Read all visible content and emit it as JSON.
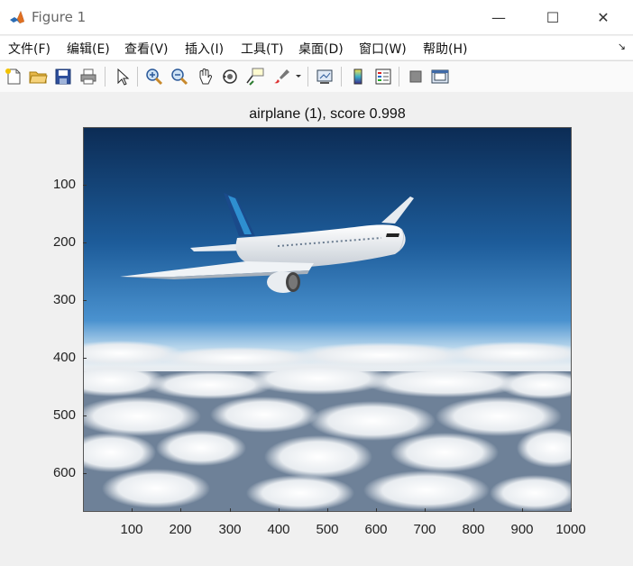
{
  "window": {
    "title": "Figure 1",
    "controls": {
      "minimize": "—",
      "maximize": "☐",
      "close": "✕"
    }
  },
  "menubar": {
    "items": [
      {
        "label": "文件(F)"
      },
      {
        "label": "编辑(E)"
      },
      {
        "label": "查看(V)"
      },
      {
        "label": "插入(I)"
      },
      {
        "label": "工具(T)"
      },
      {
        "label": "桌面(D)"
      },
      {
        "label": "窗口(W)"
      },
      {
        "label": "帮助(H)"
      }
    ],
    "dock_arrow": "↘"
  },
  "toolbar": {
    "buttons": [
      "new-figure-icon",
      "open-file-icon",
      "save-icon",
      "print-icon",
      "edit-plot-arrow-icon",
      "zoom-in-icon",
      "zoom-out-icon",
      "pan-hand-icon",
      "rotate-3d-icon",
      "data-cursor-icon",
      "brush-icon",
      "link-plot-icon",
      "colorbar-icon",
      "legend-icon",
      "hide-plot-tools-icon",
      "show-plot-tools-icon"
    ]
  },
  "axes": {
    "title": "airplane (1), score 0.998",
    "yticks": [
      "100",
      "200",
      "300",
      "400",
      "500",
      "600"
    ],
    "xticks": [
      "100",
      "200",
      "300",
      "400",
      "500",
      "600",
      "700",
      "800",
      "900",
      "1000"
    ]
  }
}
